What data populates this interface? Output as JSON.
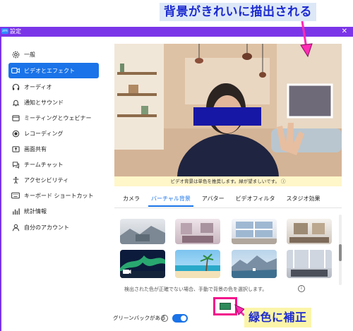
{
  "annotations": {
    "top_label": "背景がきれいに描出される",
    "bottom_label": "緑色に補正"
  },
  "window": {
    "title": "設定",
    "close": "✕",
    "logo": "zm"
  },
  "sidebar": {
    "items": [
      {
        "label": "一般",
        "icon": "gear-icon",
        "active": false
      },
      {
        "label": "ビデオとエフェクト",
        "icon": "video-camera-icon",
        "active": true
      },
      {
        "label": "オーディオ",
        "icon": "headphones-icon",
        "active": false
      },
      {
        "label": "通知とサウンド",
        "icon": "bell-icon",
        "active": false
      },
      {
        "label": "ミーティングとウェビナー",
        "icon": "meeting-icon",
        "active": false
      },
      {
        "label": "レコーディング",
        "icon": "record-icon",
        "active": false
      },
      {
        "label": "画面共有",
        "icon": "share-screen-icon",
        "active": false
      },
      {
        "label": "チームチャット",
        "icon": "chat-icon",
        "active": false
      },
      {
        "label": "アクセシビリティ",
        "icon": "accessibility-icon",
        "active": false
      },
      {
        "label": "キーボード ショートカット",
        "icon": "keyboard-icon",
        "active": false
      },
      {
        "label": "統計情報",
        "icon": "stats-icon",
        "active": false
      },
      {
        "label": "自分のアカウント",
        "icon": "user-icon",
        "active": false
      }
    ]
  },
  "preview": {
    "banner": "ビデオ背景は単色を推奨します。緑が望ましいです。 ⓘ"
  },
  "tabs": [
    {
      "label": "カメラ",
      "active": false
    },
    {
      "label": "バーチャル背景",
      "active": true
    },
    {
      "label": "アバター",
      "active": false
    },
    {
      "label": "ビデオフィルタ",
      "active": false
    },
    {
      "label": "スタジオ効果",
      "active": false
    }
  ],
  "backgrounds": {
    "hint": "検出された色が正確でない場合、手動で背景の色を選択します。",
    "info_symbol": "i",
    "selected_color": "#2e8a5a"
  },
  "green_screen": {
    "label": "グリーンバックがある",
    "info_symbol": "i",
    "enabled": true
  },
  "colors": {
    "title_bar": "#7b35e8",
    "accent": "#1a73e8",
    "highlight": "#f2128b",
    "annotation_text": "#1d2bd0"
  }
}
